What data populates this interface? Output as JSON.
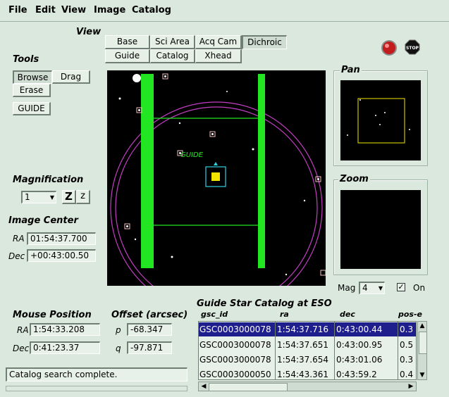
{
  "menu": [
    "File",
    "Edit",
    "View",
    "Image",
    "Catalog"
  ],
  "view": {
    "label": "View",
    "tabs_row1": [
      "Base",
      "Sci Area",
      "Acq Cam",
      "Dichroic"
    ],
    "tabs_row2": [
      "Guide",
      "Catalog",
      "Xhead"
    ],
    "selected": "Dichroic"
  },
  "tools": {
    "label": "Tools",
    "browse": "Browse",
    "drag": "Drag",
    "erase": "Erase",
    "guide": "GUIDE"
  },
  "magnification": {
    "label": "Magnification",
    "value": "1",
    "zoom_in": "Z",
    "zoom_out": "z"
  },
  "image_center": {
    "label": "Image Center",
    "ra_label": "RA",
    "ra_value": "01:54:37.700",
    "dec_label": "Dec",
    "dec_value": "+00:43:00.50"
  },
  "mouse_position": {
    "label": "Mouse Position",
    "ra_label": "RA",
    "ra_value": "1:54:33.208",
    "dec_label": "Dec",
    "dec_value": "0:41:23.37"
  },
  "offset": {
    "label": "Offset (arcsec)",
    "p_label": "p",
    "p_value": "-68.347",
    "q_label": "q",
    "q_value": "-97.871"
  },
  "main_image": {
    "guide_label": "GUIDE"
  },
  "pan": {
    "label": "Pan"
  },
  "zoom": {
    "label": "Zoom",
    "mag_label": "Mag",
    "mag_value": "4",
    "on_label": "On",
    "on_checked": true
  },
  "status": {
    "message": "Catalog search complete."
  },
  "catalog": {
    "title": "Guide Star Catalog at ESO",
    "columns": [
      "gsc_id",
      "ra",
      "dec",
      "pos-e"
    ],
    "rows": [
      [
        "GSC0003000078",
        "1:54:37.716",
        "0:43:00.44",
        "0.3"
      ],
      [
        "GSC0003000078",
        "1:54:37.651",
        "0:43:00.95",
        "0.5"
      ],
      [
        "GSC0003000078",
        "1:54:37.654",
        "0:43:01.06",
        "0.3"
      ],
      [
        "GSC0003000050",
        "1:54:43.361",
        "0:43:59.2",
        "0.4"
      ]
    ],
    "selected_row": 0
  },
  "colors": {
    "background": "#dbe8dd",
    "selection": "#1e1e8c",
    "probe_green": "#22e622",
    "circle_magenta": "#c23ec2",
    "target_yellow": "#f2e600",
    "target_cyan": "#2fd0e0"
  },
  "icons": {
    "alarm": "red-light-icon",
    "stop": "stop-sign-icon",
    "check": "checkmark-icon",
    "dropdown": "dropdown-arrow-icon"
  }
}
